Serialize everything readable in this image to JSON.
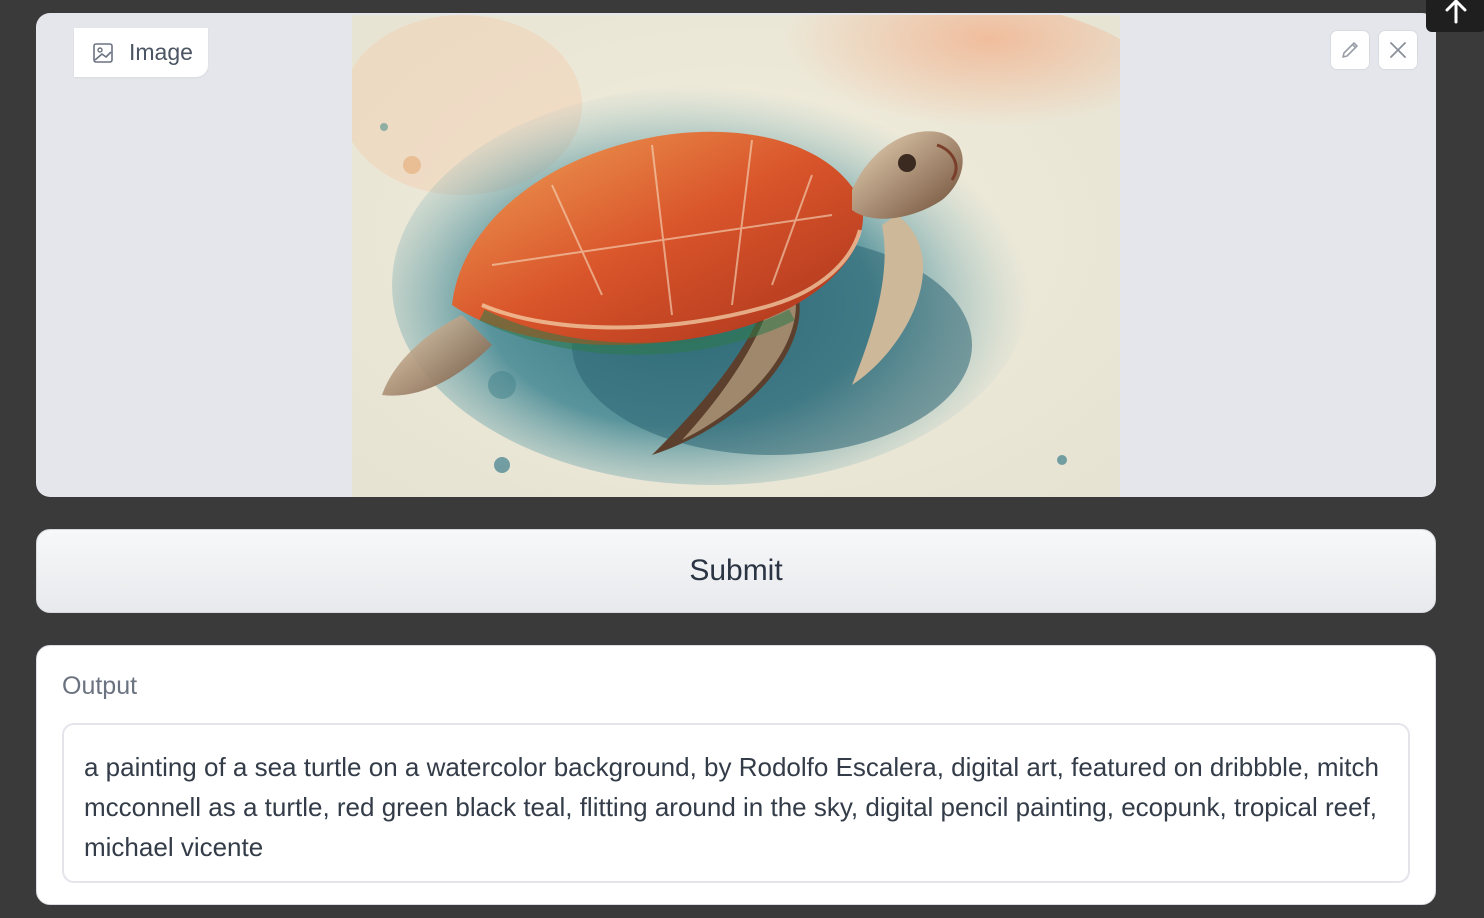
{
  "image_component": {
    "label": "Image",
    "label_icon": "image-icon",
    "edit_icon": "pencil-icon",
    "close_icon": "close-icon",
    "subject": "sea turtle watercolor painting"
  },
  "scroll_top_icon": "arrow-up-icon",
  "submit": {
    "label": "Submit"
  },
  "output": {
    "label": "Output",
    "value": "a painting of a sea turtle on a watercolor background, by Rodolfo Escalera, digital art, featured on dribbble, mitch mcconnell as a turtle, red green black teal, flitting around in the sky, digital pencil painting, ecopunk, tropical reef, michael vicente"
  },
  "colors": {
    "page_bg": "#3a3a3a",
    "panel_bg": "#e5e6eb",
    "text": "#333c48"
  }
}
